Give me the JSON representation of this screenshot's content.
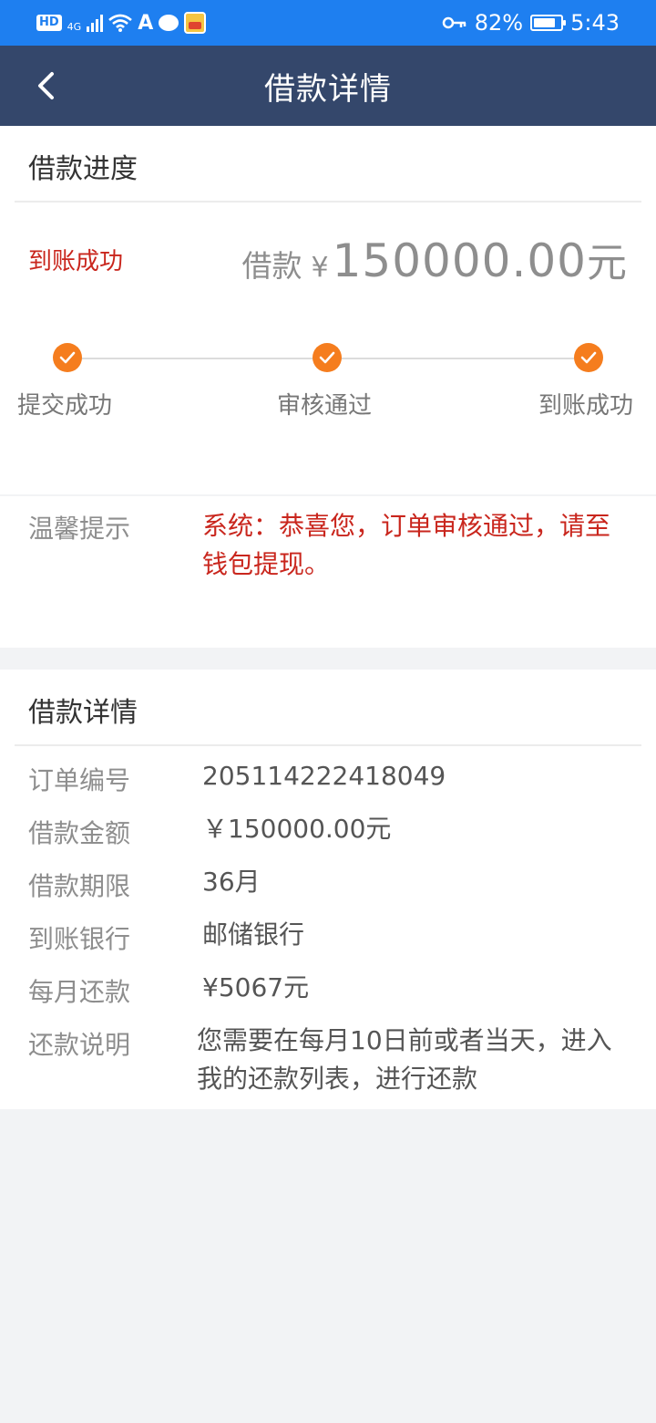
{
  "status_bar": {
    "hd_label": "HD",
    "network_label": "4G",
    "vpn_label": "A",
    "battery_percent": "82%",
    "battery_level": 0.82,
    "time": "5:43"
  },
  "navbar": {
    "title": "借款详情"
  },
  "progress": {
    "title": "借款进度",
    "status": "到账成功",
    "amount_prefix": "借款",
    "currency": "¥",
    "amount": "150000.00",
    "amount_unit": "元",
    "steps": [
      {
        "label": "提交成功"
      },
      {
        "label": "审核通过"
      },
      {
        "label": "到账成功"
      }
    ]
  },
  "tip": {
    "label": "温馨提示",
    "text": "系统：恭喜您，订单审核通过，请至钱包提现。"
  },
  "details": {
    "title": "借款详情",
    "rows": [
      {
        "key": "订单编号",
        "value": "205114222418049"
      },
      {
        "key": "借款金额",
        "value": "￥150000.00元"
      },
      {
        "key": "借款期限",
        "value": "36月"
      },
      {
        "key": "到账银行",
        "value": "邮储银行"
      },
      {
        "key": "每月还款",
        "value": "¥5067元"
      },
      {
        "key": "还款说明",
        "value": "您需要在每月10日前或者当天，进入我的还款列表，进行还款"
      }
    ]
  },
  "colors": {
    "status_bar": "#1e7ff0",
    "navbar": "#34476b",
    "accent_red": "#c9261d",
    "step_orange": "#f57d1e"
  }
}
